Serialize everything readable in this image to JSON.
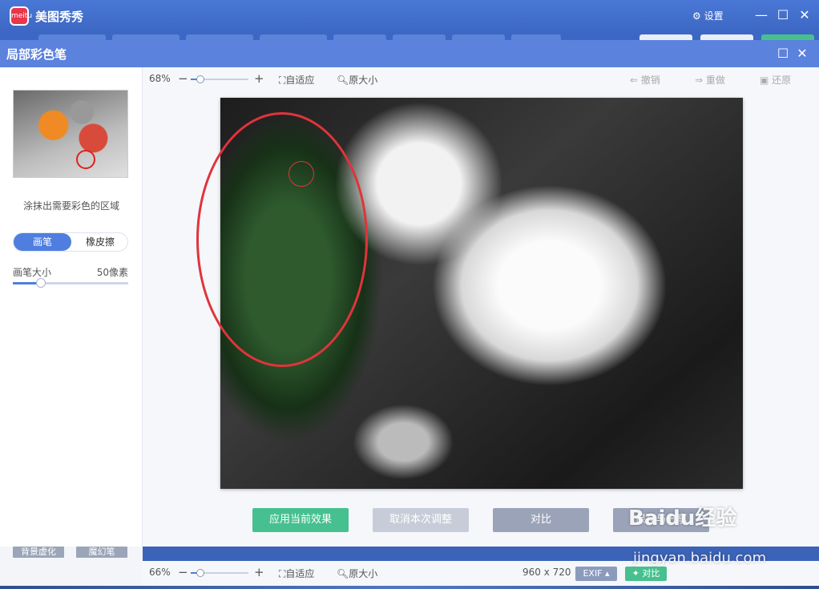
{
  "app": {
    "logo_text": "meitu",
    "title": "美图秀秀",
    "settings_label": "设置"
  },
  "panel": {
    "title": "局部彩色笔"
  },
  "sidebar": {
    "hint": "涂抹出需要彩色的区域",
    "modes": [
      "画笔",
      "橡皮擦"
    ],
    "brush_size_label": "画笔大小",
    "brush_size_value": "50像素",
    "brush_size_fraction": 0.24,
    "lower_buttons": [
      "背景虚化",
      "魔幻笔"
    ]
  },
  "toolbar": {
    "zoom": "68%",
    "zoom_fraction": 0.18,
    "fit": "自适应",
    "original": "原大小",
    "undo": "撤销",
    "redo": "重做",
    "restore": "还原"
  },
  "actions": {
    "apply": "应用当前效果",
    "cancel": "取消本次调整",
    "compare": "对比",
    "save_share": "保存与分享"
  },
  "statusbar": {
    "zoom": "66%",
    "zoom_fraction": 0.18,
    "fit": "自适应",
    "original": "原大小",
    "dimensions": "960 x 720",
    "exif": "EXIF",
    "compare": "对比"
  },
  "watermark": {
    "line1": "Baidu经验",
    "line2": "jingyan.baidu.com"
  },
  "colors": {
    "accent": "#4f7ee0",
    "apply": "#47c08f",
    "disabled": "#c7cdd8",
    "compare": "#9aa3b8",
    "titlebar": "#3d67c4"
  }
}
